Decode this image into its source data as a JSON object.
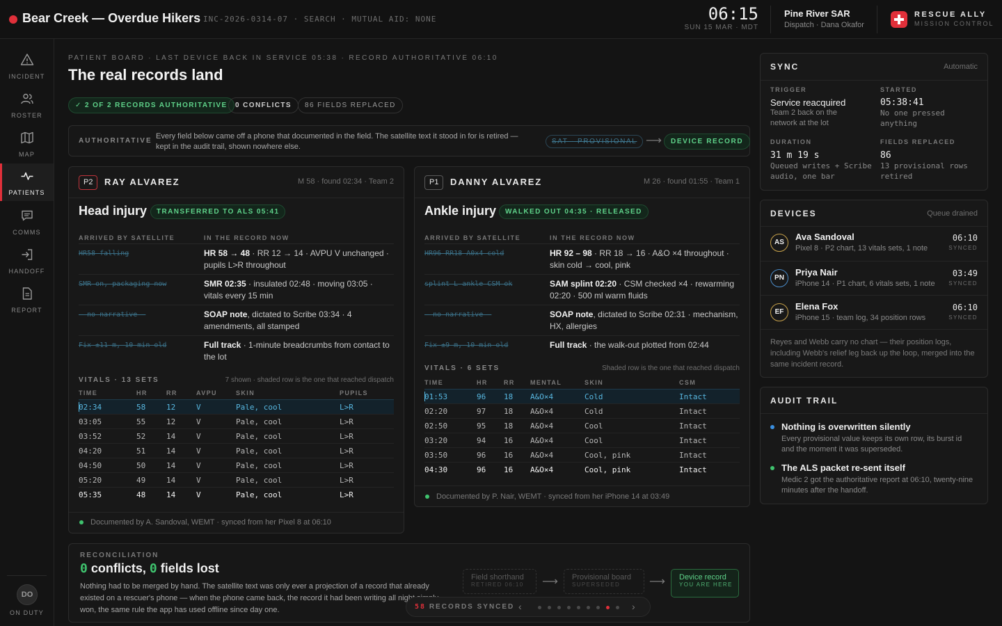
{
  "header": {
    "title": "Bear Creek — Overdue Hikers",
    "meta": "INC-2026-0314-07 · SEARCH · MUTUAL AID: NONE",
    "clock": "06:15",
    "date": "SUN 15 MAR · MDT",
    "org": "Pine River SAR",
    "dispatcher": "Dispatch · Dana Okafor",
    "brand": "RESCUE ALLY",
    "brand_sub": "MISSION CONTROL"
  },
  "sidebar": {
    "items": [
      {
        "label": "INCIDENT",
        "icon": "warning-icon"
      },
      {
        "label": "ROSTER",
        "icon": "people-icon"
      },
      {
        "label": "MAP",
        "icon": "map-icon"
      },
      {
        "label": "PATIENTS",
        "icon": "pulse-icon",
        "active": true
      },
      {
        "label": "COMMS",
        "icon": "chat-icon"
      },
      {
        "label": "HANDOFF",
        "icon": "handoff-icon"
      },
      {
        "label": "REPORT",
        "icon": "document-icon"
      }
    ],
    "user_initials": "DO",
    "user_status": "ON DUTY"
  },
  "main": {
    "eyebrow": "PATIENT BOARD · LAST DEVICE BACK IN SERVICE 05:38 · RECORD AUTHORITATIVE 06:10",
    "title": "The real records land",
    "chips": [
      "✓ 2 OF 2 RECORDS AUTHORITATIVE",
      "0 CONFLICTS",
      "86 FIELDS REPLACED"
    ],
    "auth": {
      "label": "AUTHORITATIVE",
      "text": "Every field below came off a phone that documented in the field. The satellite text it stood in for is retired — kept in the audit trail, shown nowhere else.",
      "from": "SAT · PROVISIONAL",
      "to": "DEVICE RECORD"
    }
  },
  "patients": [
    {
      "priority": "P2",
      "name": "RAY ALVAREZ",
      "meta": "M 58 · found 02:34 · Team 2",
      "dx": "Head injury",
      "status": "TRANSFERRED TO ALS 05:41",
      "col_old": "ARRIVED BY SATELLITE",
      "col_new": "IN THE RECORD NOW",
      "records": [
        {
          "old": "HR58 falling",
          "new_b": "HR 58 → 48",
          "new": " · RR 12 → 14 · AVPU V unchanged · pupils L>R throughout"
        },
        {
          "old": "SMR on, packaging now",
          "new_b": "SMR 02:35",
          "new": " · insulated 02:48 · moving 03:05 · vitals every 15 min"
        },
        {
          "old": "— no narrative —",
          "new_b": "SOAP note",
          "new": ", dictated to Scribe 03:34 · 4 amendments, all stamped"
        },
        {
          "old": "Fix ±11 m, 10 min old",
          "new_b": "Full track",
          "new": " · 1-minute breadcrumbs from contact to the lot"
        }
      ],
      "vitals_title": "VITALS · 13 SETS",
      "vitals_note": "7 shown · shaded row is the one that reached dispatch",
      "vitals_cols": [
        "TIME",
        "HR",
        "RR",
        "AVPU",
        "SKIN",
        "PUPILS"
      ],
      "vitals": [
        [
          "02:34",
          "58",
          "12",
          "V",
          "Pale, cool",
          "L>R"
        ],
        [
          "03:05",
          "55",
          "12",
          "V",
          "Pale, cool",
          "L>R"
        ],
        [
          "03:52",
          "52",
          "14",
          "V",
          "Pale, cool",
          "L>R"
        ],
        [
          "04:20",
          "51",
          "14",
          "V",
          "Pale, cool",
          "L>R"
        ],
        [
          "04:50",
          "50",
          "14",
          "V",
          "Pale, cool",
          "L>R"
        ],
        [
          "05:20",
          "49",
          "14",
          "V",
          "Pale, cool",
          "L>R"
        ],
        [
          "05:35",
          "48",
          "14",
          "V",
          "Pale, cool",
          "L>R"
        ]
      ],
      "footer": "Documented by A. Sandoval, WEMT · synced from her Pixel 8 at 06:10"
    },
    {
      "priority": "P1",
      "name": "DANNY ALVAREZ",
      "meta": "M 26 · found 01:55 · Team 1",
      "dx": "Ankle injury",
      "status": "WALKED OUT 04:35 · RELEASED",
      "col_old": "ARRIVED BY SATELLITE",
      "col_new": "IN THE RECORD NOW",
      "records": [
        {
          "old": "HR96 RR18 A0x4 cold",
          "new_b": "HR 92 – 98",
          "new": " · RR 18 → 16 · A&O ×4 throughout · skin cold → cool, pink"
        },
        {
          "old": "splint L ankle CSM ok",
          "new_b": "SAM splint 02:20",
          "new": " · CSM checked ×4 · rewarming 02:20 · 500 ml warm fluids"
        },
        {
          "old": "— no narrative —",
          "new_b": "SOAP note",
          "new": ", dictated to Scribe 02:31 · mechanism, HX, allergies"
        },
        {
          "old": "Fix ±9 m, 10 min old",
          "new_b": "Full track",
          "new": " · the walk-out plotted from 02:44"
        }
      ],
      "vitals_title": "VITALS · 6 SETS",
      "vitals_note": "Shaded row is the one that reached dispatch",
      "vitals_cols": [
        "TIME",
        "HR",
        "RR",
        "MENTAL",
        "SKIN",
        "CSM"
      ],
      "vitals": [
        [
          "01:53",
          "96",
          "18",
          "A&O×4",
          "Cold",
          "Intact"
        ],
        [
          "02:20",
          "97",
          "18",
          "A&O×4",
          "Cold",
          "Intact"
        ],
        [
          "02:50",
          "95",
          "18",
          "A&O×4",
          "Cool",
          "Intact"
        ],
        [
          "03:20",
          "94",
          "16",
          "A&O×4",
          "Cool",
          "Intact"
        ],
        [
          "03:50",
          "96",
          "16",
          "A&O×4",
          "Cool, pink",
          "Intact"
        ],
        [
          "04:30",
          "96",
          "16",
          "A&O×4",
          "Cool, pink",
          "Intact"
        ]
      ],
      "footer": "Documented by P. Nair, WEMT · synced from her iPhone 14 at 03:49"
    }
  ],
  "reconciliation": {
    "label": "RECONCILIATION",
    "conflicts": "0",
    "conflicts_label": " conflicts, ",
    "lost": "0",
    "lost_label": " fields lost",
    "text": "Nothing had to be merged by hand. The satellite text was only ever a projection of a record that already existed on a rescuer's phone — when the phone came back, the record it had been writing all night simply won, the same rule the app has used offline since day one.",
    "stages": [
      {
        "title": "Field shorthand",
        "sub": "RETIRED 06:10"
      },
      {
        "title": "Provisional board",
        "sub": "SUPERSEDED"
      },
      {
        "title": "Device record",
        "sub": "YOU ARE HERE"
      }
    ]
  },
  "pager": {
    "count": "58",
    "label": " RECORDS SYNCED",
    "pages": 9,
    "current": 8
  },
  "sync": {
    "title": "SYNC",
    "mode": "Automatic",
    "trigger_k": "TRIGGER",
    "trigger_v": "Service reacquired",
    "trigger_s": "Team 2 back on the network at the lot",
    "started_k": "STARTED",
    "started_v": "05:38:41",
    "started_s": "No one pressed anything",
    "duration_k": "DURATION",
    "duration_v": "31 m 19 s",
    "duration_s": "Queued writes + Scribe audio, one bar",
    "fields_k": "FIELDS REPLACED",
    "fields_v": "86",
    "fields_s": "13 provisional rows retired"
  },
  "devices": {
    "title": "DEVICES",
    "status": "Queue drained",
    "items": [
      {
        "initials": "AS",
        "name": "Ava Sandoval",
        "detail": "Pixel 8 · P2 chart, 13 vitals sets, 1 note",
        "time": "06:10",
        "state": "SYNCED",
        "color": "#c8a24a"
      },
      {
        "initials": "PN",
        "name": "Priya Nair",
        "detail": "iPhone 14 · P1 chart, 6 vitals sets, 1 note",
        "time": "03:49",
        "state": "SYNCED",
        "color": "#4a8bc8"
      },
      {
        "initials": "EF",
        "name": "Elena Fox",
        "detail": "iPhone 15 · team log, 34 position rows",
        "time": "06:10",
        "state": "SYNCED",
        "color": "#c8a24a"
      }
    ],
    "note": "Reyes and Webb carry no chart — their position logs, including Webb's relief leg back up the loop, merged into the same incident record."
  },
  "audit": {
    "title": "AUDIT TRAIL",
    "items": [
      {
        "title": "Nothing is overwritten silently",
        "text": "Every provisional value keeps its own row, its burst id and the moment it was superseded.",
        "color": "#3a8fe0"
      },
      {
        "title": "The ALS packet re-sent itself",
        "text": "Medic 2 got the authoritative report at 06:10, twenty-nine minutes after the handoff.",
        "color": "#3fc36e"
      }
    ]
  }
}
